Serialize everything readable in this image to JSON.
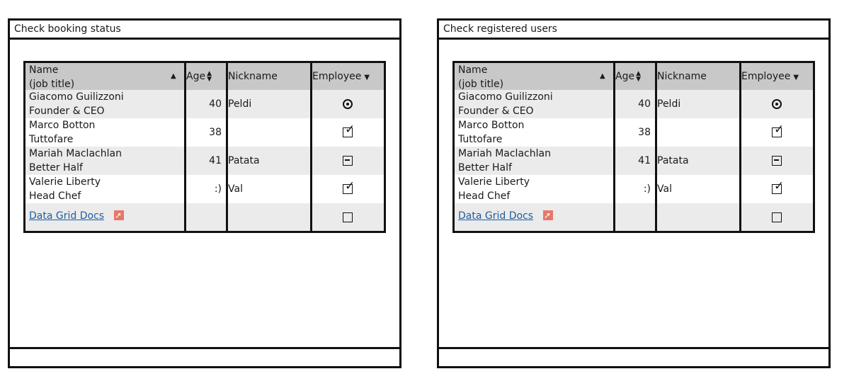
{
  "panels": [
    {
      "title": "Check booking status",
      "grid": {
        "columns": {
          "name_line1": "Name",
          "name_line2": "(job title)",
          "age": "Age",
          "nickname": "Nickname",
          "employee": "Employee"
        },
        "rows": [
          {
            "name": "Giacomo Guilizzoni",
            "title": "Founder & CEO",
            "age": "40",
            "nickname": "Peldi",
            "employee": "radio-selected"
          },
          {
            "name": "Marco Botton",
            "title": "Tuttofare",
            "age": "38",
            "nickname": "",
            "employee": "checked"
          },
          {
            "name": "Mariah Maclachlan",
            "title": "Better Half",
            "age": "41",
            "nickname": "Patata",
            "employee": "indeterminate"
          },
          {
            "name": "Valerie Liberty",
            "title": "Head Chef",
            "age": ":)",
            "nickname": "Val",
            "employee": "checked"
          }
        ],
        "link": "Data Grid Docs"
      }
    },
    {
      "title": "Check registered users",
      "grid": {
        "columns": {
          "name_line1": "Name",
          "name_line2": "(job title)",
          "age": "Age",
          "nickname": "Nickname",
          "employee": "Employee"
        },
        "rows": [
          {
            "name": "Giacomo Guilizzoni",
            "title": "Founder & CEO",
            "age": "40",
            "nickname": "Peldi",
            "employee": "radio-selected"
          },
          {
            "name": "Marco Botton",
            "title": "Tuttofare",
            "age": "38",
            "nickname": "",
            "employee": "checked"
          },
          {
            "name": "Mariah Maclachlan",
            "title": "Better Half",
            "age": "41",
            "nickname": "Patata",
            "employee": "indeterminate"
          },
          {
            "name": "Valerie Liberty",
            "title": "Head Chef",
            "age": ":)",
            "nickname": "Val",
            "employee": "checked"
          }
        ],
        "link": "Data Grid Docs"
      }
    }
  ],
  "colors": {
    "header_bg": "#c8c8c8",
    "row_alt": "#ebebeb",
    "link": "#1f5c9e",
    "external_icon": "#e8776b"
  },
  "icons": {
    "sort_name": "sort-ascending-icon",
    "sort_age": "sort-both-icon",
    "sort_employee": "dropdown-arrow-icon",
    "link": "external-link-icon"
  }
}
